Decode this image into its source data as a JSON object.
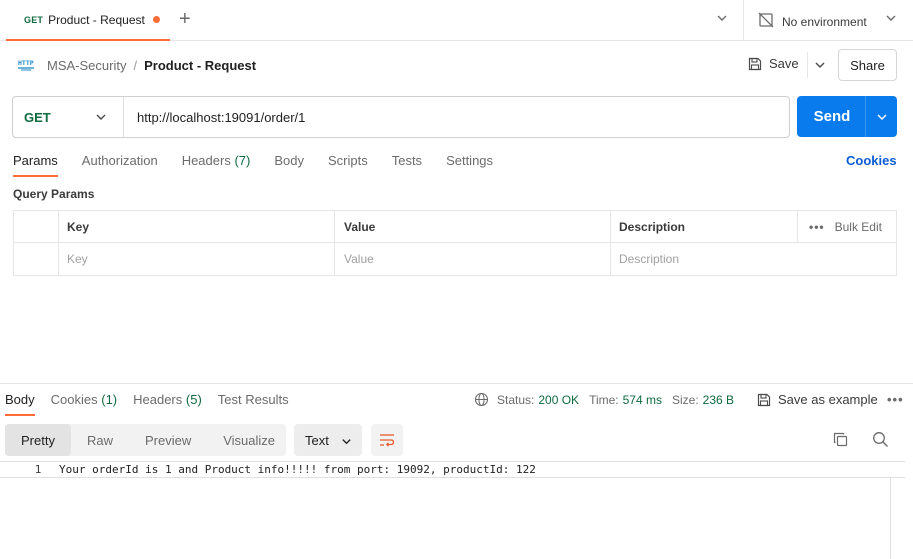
{
  "tabbar": {
    "tab_method": "GET",
    "tab_title": "Product - Request",
    "environment": "No environment"
  },
  "breadcrumb": {
    "parent": "MSA-Security",
    "separator": "/",
    "current": "Product - Request",
    "http_badge": "HTTP"
  },
  "actions": {
    "save_label": "Save",
    "share_label": "Share"
  },
  "request": {
    "method": "GET",
    "url": "http://localhost:19091/order/1",
    "send_label": "Send"
  },
  "request_tabs": [
    {
      "label": "Params",
      "count": "",
      "active": true
    },
    {
      "label": "Authorization",
      "count": "",
      "active": false
    },
    {
      "label": "Headers",
      "count": "(7)",
      "active": false
    },
    {
      "label": "Body",
      "count": "",
      "active": false
    },
    {
      "label": "Scripts",
      "count": "",
      "active": false
    },
    {
      "label": "Tests",
      "count": "",
      "active": false
    },
    {
      "label": "Settings",
      "count": "",
      "active": false
    }
  ],
  "cookies_link": "Cookies",
  "query_params": {
    "title": "Query Params",
    "columns": {
      "key": "Key",
      "value": "Value",
      "description": "Description"
    },
    "bulk_edit": "Bulk Edit",
    "placeholders": {
      "key": "Key",
      "value": "Value",
      "description": "Description"
    }
  },
  "response_tabs": [
    {
      "label": "Body",
      "count": "",
      "active": true
    },
    {
      "label": "Cookies",
      "count": "(1)",
      "active": false
    },
    {
      "label": "Headers",
      "count": "(5)",
      "active": false
    },
    {
      "label": "Test Results",
      "count": "",
      "active": false
    }
  ],
  "response_status": {
    "status_key": "Status:",
    "status_value": "200 OK",
    "time_key": "Time:",
    "time_value": "574 ms",
    "size_key": "Size:",
    "size_value": "236 B",
    "save_example": "Save as example"
  },
  "view_modes": [
    "Pretty",
    "Raw",
    "Preview",
    "Visualize"
  ],
  "active_view": "Pretty",
  "format": "Text",
  "response_body": {
    "line_number": "1",
    "text": "Your orderId is 1 and Product info!!!!! from port: 19092, productId: 122"
  },
  "colors": {
    "accent": "#ff6c37",
    "send": "#097bed",
    "method_get": "#0f6b3f",
    "link": "#0b5cd5"
  }
}
